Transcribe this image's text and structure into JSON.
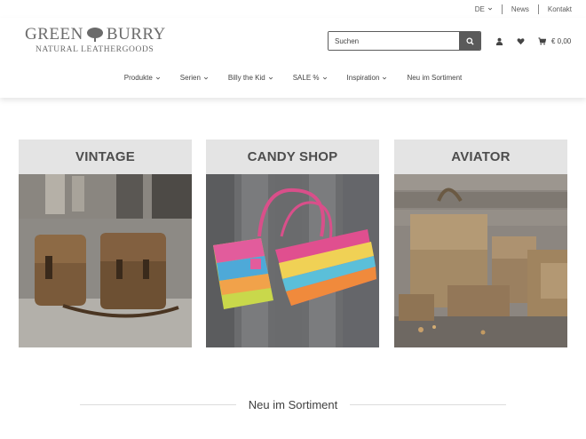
{
  "topbar": {
    "language": "DE",
    "links": [
      "News",
      "Kontakt"
    ]
  },
  "logo": {
    "word1": "GREEN",
    "word2": "BURRY",
    "tagline": "NATURAL LEATHERGOODS"
  },
  "search": {
    "placeholder": "Suchen"
  },
  "cart": {
    "total": "€ 0,00"
  },
  "nav": {
    "items": [
      {
        "label": "Produkte",
        "dropdown": true
      },
      {
        "label": "Serien",
        "dropdown": true
      },
      {
        "label": "Billy the Kid",
        "dropdown": true
      },
      {
        "label": "SALE %",
        "dropdown": true
      },
      {
        "label": "Inspiration",
        "dropdown": true
      },
      {
        "label": "Neu im Sortiment",
        "dropdown": false
      }
    ]
  },
  "categories": [
    {
      "title": "VINTAGE"
    },
    {
      "title": "CANDY SHOP"
    },
    {
      "title": "AVIATOR"
    }
  ],
  "section": {
    "heading": "Neu im Sortiment"
  },
  "colors": {
    "accent": "#5a5a5a",
    "card_header": "#e4e4e4",
    "text": "#4a4a4a"
  }
}
